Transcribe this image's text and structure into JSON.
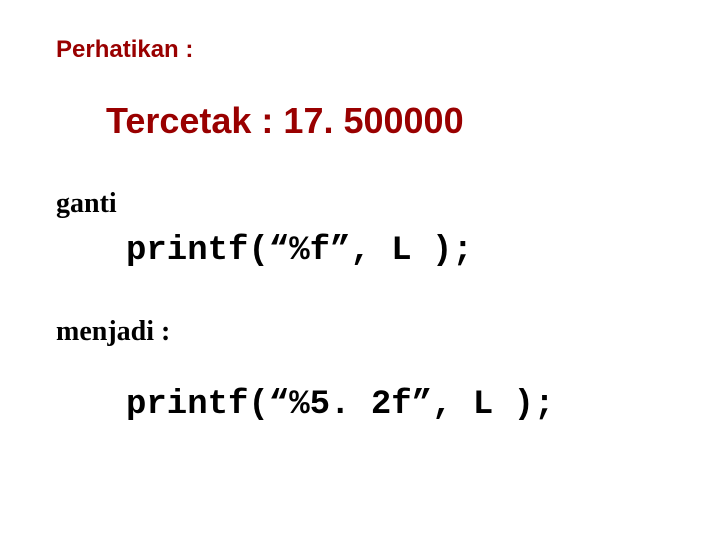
{
  "heading1": "Perhatikan :",
  "heading2": "Tercetak : 17. 500000",
  "label_ganti": "ganti",
  "code1": "printf(“%f”, L );",
  "label_menjadi": "menjadi :",
  "code2": "printf(“%5. 2f”, L );"
}
